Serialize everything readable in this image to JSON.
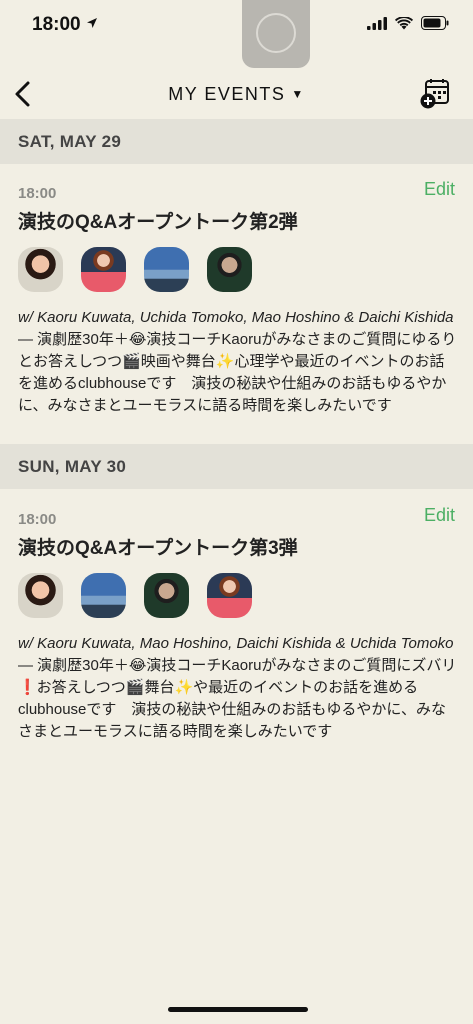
{
  "status": {
    "time": "18:00",
    "icons": [
      "location-arrow-icon",
      "signal-icon",
      "wifi-icon",
      "battery-icon"
    ]
  },
  "nav": {
    "title": "MY EVENTS",
    "caret": "▼",
    "back_icon": "chevron-left-icon",
    "calendar_icon": "calendar-add-icon"
  },
  "sections": [
    {
      "header": "SAT, MAY 29",
      "event": {
        "time": "18:00",
        "edit_label": "Edit",
        "title": "演技のQ&Aオープントーク第2弾",
        "names": "w/ Kaoru Kuwata, Uchida Tomoko, Mao Hoshino & Daichi Kishida",
        "description": " — 演劇歴30年＋😂演技コーチKaoruがみなさまのご質問にゆるりとお答えしつつ🎬映画や舞台✨心理学や最近のイベントのお話を進めるclubhouseです　演技の秘訣や仕組みのお話もゆるやかに、みなさまとユーモラスに語る時間を楽しみたいです"
      }
    },
    {
      "header": "SUN, MAY 30",
      "event": {
        "time": "18:00",
        "edit_label": "Edit",
        "title": "演技のQ&Aオープントーク第3弾",
        "names": "w/ Kaoru Kuwata, Mao Hoshino, Daichi Kishida & Uchida Tomoko",
        "description": " — 演劇歴30年＋😂演技コーチKaoruがみなさまのご質問にズバリ❗️お答えしつつ🎬舞台✨や最近のイベントのお話を進めるclubhouseです　演技の秘訣や仕組みのお話もゆるやかに、みなさまとユーモラスに語る時間を楽しみたいです"
      }
    }
  ],
  "colors": {
    "background": "#f2efe4",
    "section_header": "#e3e1d8",
    "edit_accent": "#4caf64"
  }
}
